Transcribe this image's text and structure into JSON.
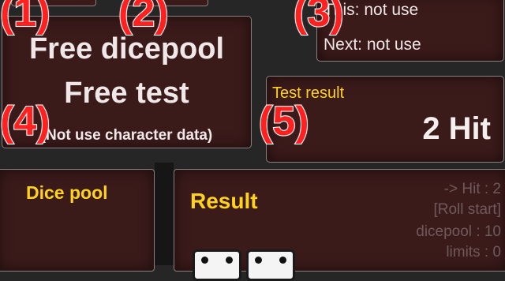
{
  "main_button": {
    "line1": "Free dicepool",
    "line2": "Free test",
    "line3": "(Not use character data)"
  },
  "info_panel": {
    "row1": "This: not use",
    "row2": "Next: not use"
  },
  "test_result": {
    "label": "Test result",
    "value": "2 Hit"
  },
  "dice_pool": {
    "title": "Dice pool"
  },
  "result_log": {
    "title": "Result",
    "lines": [
      "-> Hit : 2",
      "[Roll start]",
      "dicepool : 10",
      "limits : 0"
    ]
  },
  "annotations": [
    "(1)",
    "(2)",
    "(3)",
    "(4)",
    "(5)"
  ],
  "colors": {
    "panel": "#3b1a1a",
    "label_yellow": "#ffd21e",
    "annotation_red": "#ff2020"
  }
}
